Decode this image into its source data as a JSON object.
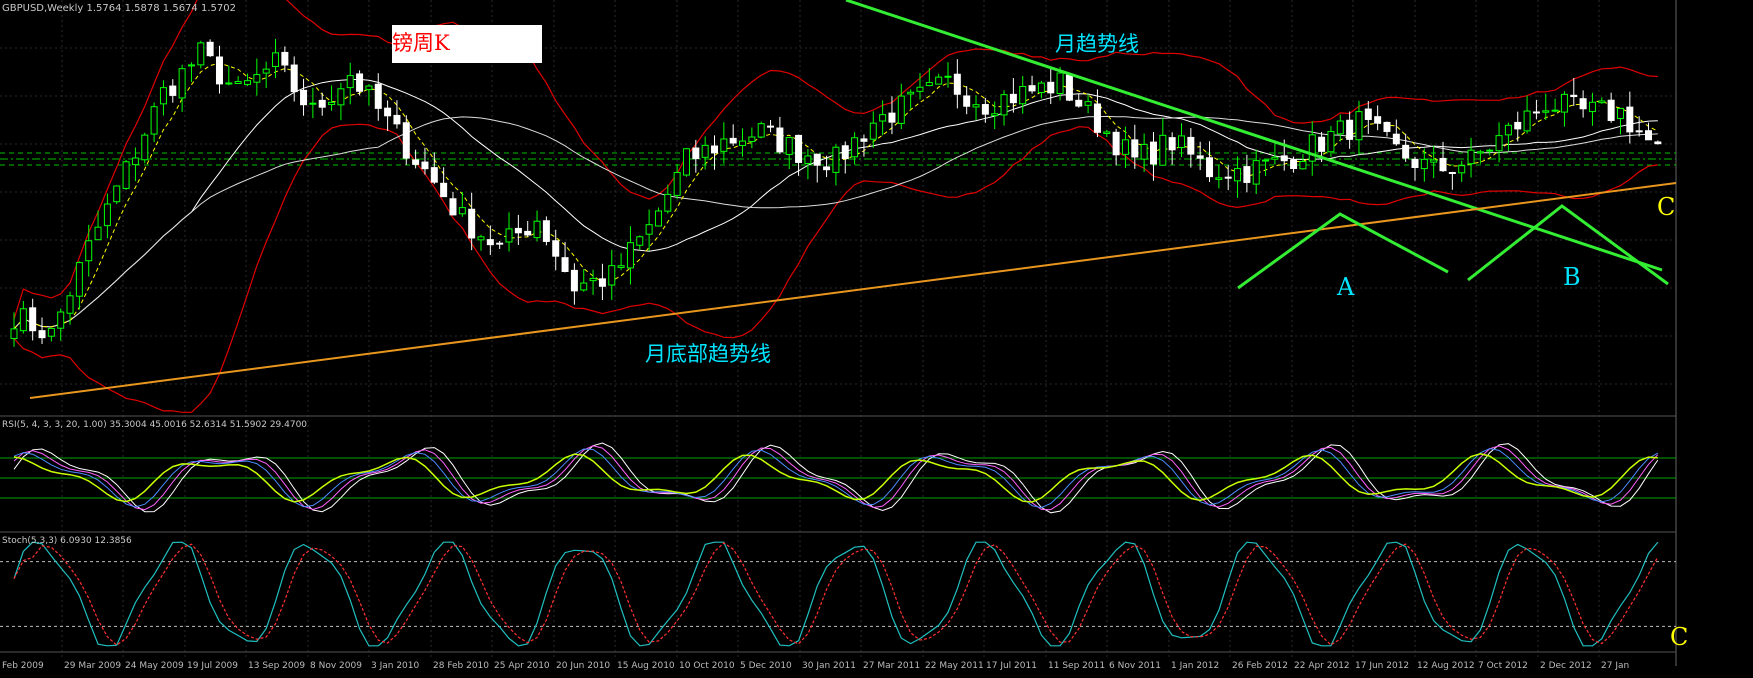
{
  "window": {
    "title": "GBPUSD,Weekly  1.5764 1.5878 1.5674 1.5702",
    "rsi_label": "RSI(5, 4, 3, 3, 20, 1.00) 35.3004 45.0016 52.6314 51.5902 29.4700",
    "stoch_label": "Stoch(5,3,3) 6.0930 12.3856"
  },
  "annotations": {
    "box_title": "镑周K",
    "month_trend_top": "月趋势线",
    "month_trend_bottom": "月底部趋势线",
    "label_a": "A",
    "label_b": "B",
    "label_c_price": "C",
    "label_c_stoch": "C"
  },
  "colors": {
    "background": "#000000",
    "bull_candle": "#00ff00",
    "bear_candle": "#ffffff",
    "bollinger": "#e00000",
    "ma": "#ffffff",
    "signal_ma": "#ffff00",
    "green_trend": "#33ee33",
    "bottom_trend": "#e8961e",
    "stoch_main": "#20c0c0",
    "stoch_signal": "#ff3030",
    "annotation_text": "#00e5ff",
    "c_marker": "#ffff00"
  },
  "chart_data": {
    "type": "candlestick",
    "symbol": "GBPUSD",
    "timeframe": "Weekly",
    "quote": {
      "open": 1.5764,
      "high": 1.5878,
      "low": 1.5674,
      "close": 1.5702
    },
    "x_tick_labels": [
      "Feb 2009",
      "29 Mar 2009",
      "24 May 2009",
      "19 Jul 2009",
      "13 Sep 2009",
      "8 Nov 2009",
      "3 Jan 2010",
      "28 Feb 2010",
      "25 Apr 2010",
      "20 Jun 2010",
      "15 Aug 2010",
      "10 Oct 2010",
      "5 Dec 2010",
      "30 Jan 2011",
      "27 Mar 2011",
      "22 May 2011",
      "17 Jul 2011",
      "11 Sep 2011",
      "6 Nov 2011",
      "1 Jan 2012",
      "26 Feb 2012",
      "22 Apr 2012",
      "17 Jun 2012",
      "12 Aug 2012",
      "7 Oct 2012",
      "2 Dec 2012",
      "27 Jan"
    ],
    "price_anchors": [
      {
        "week": 0,
        "close": 1.4
      },
      {
        "week": 4,
        "close": 1.38
      },
      {
        "week": 8,
        "close": 1.47
      },
      {
        "week": 12,
        "close": 1.55
      },
      {
        "week": 16,
        "close": 1.63
      },
      {
        "week": 20,
        "close": 1.67
      },
      {
        "week": 24,
        "close": 1.63
      },
      {
        "week": 28,
        "close": 1.66
      },
      {
        "week": 32,
        "close": 1.61
      },
      {
        "week": 36,
        "close": 1.65
      },
      {
        "week": 40,
        "close": 1.6
      },
      {
        "week": 44,
        "close": 1.55
      },
      {
        "week": 48,
        "close": 1.5
      },
      {
        "week": 52,
        "close": 1.47
      },
      {
        "week": 56,
        "close": 1.5
      },
      {
        "week": 60,
        "close": 1.43
      },
      {
        "week": 64,
        "close": 1.44
      },
      {
        "week": 68,
        "close": 1.49
      },
      {
        "week": 72,
        "close": 1.56
      },
      {
        "week": 76,
        "close": 1.58
      },
      {
        "week": 80,
        "close": 1.59
      },
      {
        "week": 84,
        "close": 1.57
      },
      {
        "week": 88,
        "close": 1.56
      },
      {
        "week": 92,
        "close": 1.6
      },
      {
        "week": 96,
        "close": 1.62
      },
      {
        "week": 100,
        "close": 1.64
      },
      {
        "week": 104,
        "close": 1.62
      },
      {
        "week": 108,
        "close": 1.63
      },
      {
        "week": 112,
        "close": 1.64
      },
      {
        "week": 116,
        "close": 1.6
      },
      {
        "week": 120,
        "close": 1.56
      },
      {
        "week": 124,
        "close": 1.58
      },
      {
        "week": 128,
        "close": 1.55
      },
      {
        "week": 132,
        "close": 1.55
      },
      {
        "week": 136,
        "close": 1.56
      },
      {
        "week": 140,
        "close": 1.58
      },
      {
        "week": 144,
        "close": 1.6
      },
      {
        "week": 148,
        "close": 1.57
      },
      {
        "week": 152,
        "close": 1.55
      },
      {
        "week": 156,
        "close": 1.56
      },
      {
        "week": 160,
        "close": 1.59
      },
      {
        "week": 164,
        "close": 1.62
      },
      {
        "week": 168,
        "close": 1.61
      },
      {
        "week": 172,
        "close": 1.61
      },
      {
        "week": 176,
        "close": 1.57
      }
    ],
    "bollinger": {
      "period": 20,
      "deviations": 2
    },
    "rsi_panel": {
      "levels": [
        70,
        50,
        30
      ]
    },
    "stoch_panel": {
      "k": 5,
      "d": 3,
      "slowing": 3,
      "levels": [
        80,
        20
      ]
    }
  }
}
